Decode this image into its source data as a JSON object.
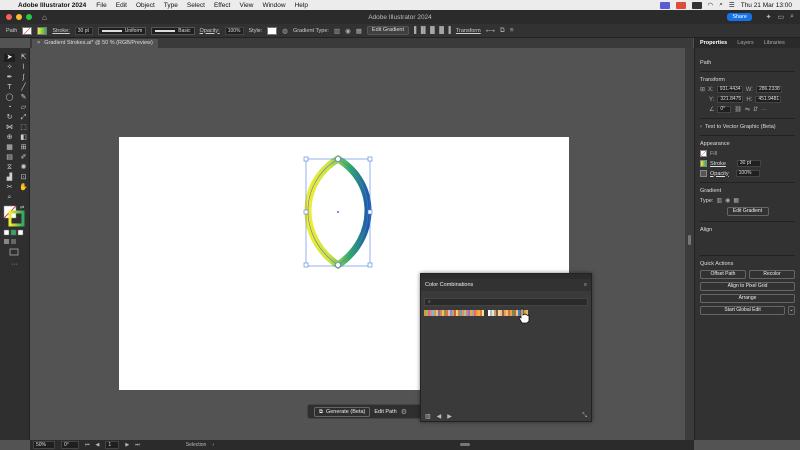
{
  "menubar": {
    "app_name": "Adobe Illustrator 2024",
    "items": [
      "File",
      "Edit",
      "Object",
      "Type",
      "Select",
      "Effect",
      "View",
      "Window",
      "Help"
    ],
    "datetime": "Thu 21 Mar  13:00"
  },
  "titlebar": {
    "title": "Adobe Illustrator 2024",
    "share_label": "Share"
  },
  "controlbar": {
    "selection_type": "Path",
    "stroke_label": "Stroke:",
    "stroke_weight": "30 pt",
    "profile_label": "Uniform",
    "brush_label": "Basic",
    "opacity_label": "Opacity:",
    "opacity_value": "100%",
    "style_label": "Style:",
    "gradient_type_label": "Gradient Type:",
    "edit_gradient_label": "Edit Gradient",
    "transform_label": "Transform"
  },
  "document": {
    "tab_title": "Gradient Strokes.ai* @ 50 % (RGB/Preview)"
  },
  "generate_bar": {
    "generate_label": "Generate (Beta)",
    "edit_path_label": "Edit Path"
  },
  "color_combinations": {
    "title": "Color Combinations",
    "search_placeholder": "",
    "swatch_groups": [
      [
        "#c9a13a",
        "#a8b35c",
        "#e06d7a",
        "#d9899c",
        "#8ab0d6",
        "#c6a14d",
        "#e3c07c",
        "#9c6aa8",
        "#d78557",
        "#f0c35c",
        "#7e9c4b",
        "#f26a45",
        "#e8b2c4",
        "#7f93c9",
        "#b7a56a",
        "#d85d40",
        "#f1d08a",
        "#c48b3e",
        "#6fa3a8",
        "#e98a6d",
        "#b4c775",
        "#d17f9e",
        "#8a7bc2",
        "#f0a44b",
        "#a5a5a5",
        "#e56b5d",
        "#f39c38",
        "#f3b048",
        "#e57838",
        "#f0e0a6"
      ],
      [
        "#ffffff",
        "#b8b8b8",
        "#e6e6e6",
        "#c0a070",
        "#7c5a3a",
        "#f4d68c",
        "#d9c3a2",
        "#a06040",
        "#e7a35a",
        "#f0c080",
        "#c47a3c",
        "#f29f3c",
        "#6f8b5a",
        "#b86a3a",
        "#e8c5a0",
        "#4a7ab8",
        "#e89040",
        "#8cc86a",
        "#d8a030",
        "#f0b070"
      ]
    ]
  },
  "properties_panel": {
    "tabs": [
      "Properties",
      "Layers",
      "Libraries"
    ],
    "selection_type": "Path",
    "transform": {
      "header": "Transform",
      "x": "931.4434",
      "y": "321.8475",
      "w": "286.2338",
      "h": "451.9481",
      "angle": "0°"
    },
    "text_to_vector_label": "Text to Vector Graphic (Beta)",
    "appearance": {
      "header": "Appearance",
      "fill_label": "Fill",
      "stroke_label": "Stroke",
      "stroke_weight": "30 pt",
      "opacity_label": "Opacity",
      "opacity_value": "100%"
    },
    "gradient": {
      "header": "Gradient",
      "type_label": "Type:",
      "edit_gradient_label": "Edit Gradient"
    },
    "align": {
      "header": "Align"
    },
    "quick_actions": {
      "header": "Quick Actions",
      "offset_path_label": "Offset Path",
      "recolor_label": "Recolor",
      "align_pixel_grid_label": "Align to Pixel Grid",
      "arrange_label": "Arrange",
      "start_global_edit_label": "Start Global Edit"
    }
  },
  "statusbar": {
    "zoom": "50%",
    "rotation": "0°",
    "artboard_number": "1",
    "tool_name": "Selection"
  },
  "colors": {
    "accent": "#1473e6",
    "gradient_stops": [
      "#f2ec2e",
      "#2eaa62",
      "#1d5aa8"
    ]
  }
}
